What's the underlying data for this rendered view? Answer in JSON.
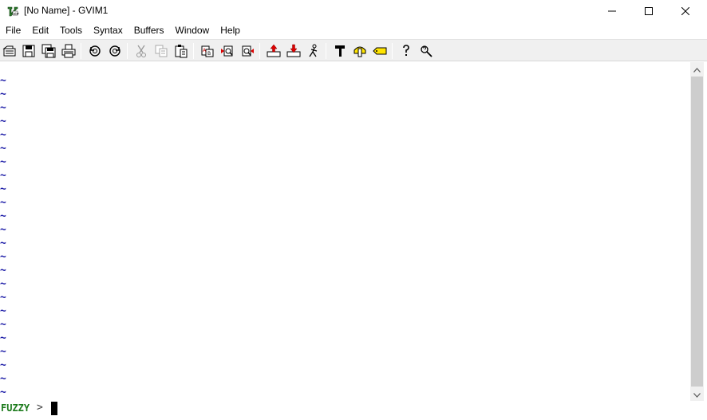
{
  "window": {
    "title": "[No Name] - GVIM1",
    "icon": "gvim-app-icon",
    "controls": {
      "minimize": "minimize-icon",
      "maximize": "maximize-icon",
      "close": "close-icon"
    }
  },
  "menubar": {
    "items": [
      "File",
      "Edit",
      "Tools",
      "Syntax",
      "Buffers",
      "Window",
      "Help"
    ]
  },
  "toolbar": {
    "buttons": [
      "open-icon",
      "save-icon",
      "save-all-icon",
      "print-icon",
      "undo-icon",
      "redo-icon",
      "cut-icon",
      "copy-icon",
      "paste-icon",
      "replace-icon",
      "find-next-icon",
      "find-prev-icon",
      "load-session-icon",
      "save-session-icon",
      "run-script-icon",
      "make-icon",
      "shell-icon",
      "tags-icon",
      "help-icon",
      "find-help-icon"
    ]
  },
  "editor": {
    "empty_line_marker": "~",
    "empty_line_count": 24
  },
  "cmdline": {
    "mode": "FUZZY",
    "arrow": ">"
  },
  "colors": {
    "tilde": "#1a1aa6",
    "mode": "#1b7a1b",
    "toolbar_bg": "#f0f0f0"
  }
}
